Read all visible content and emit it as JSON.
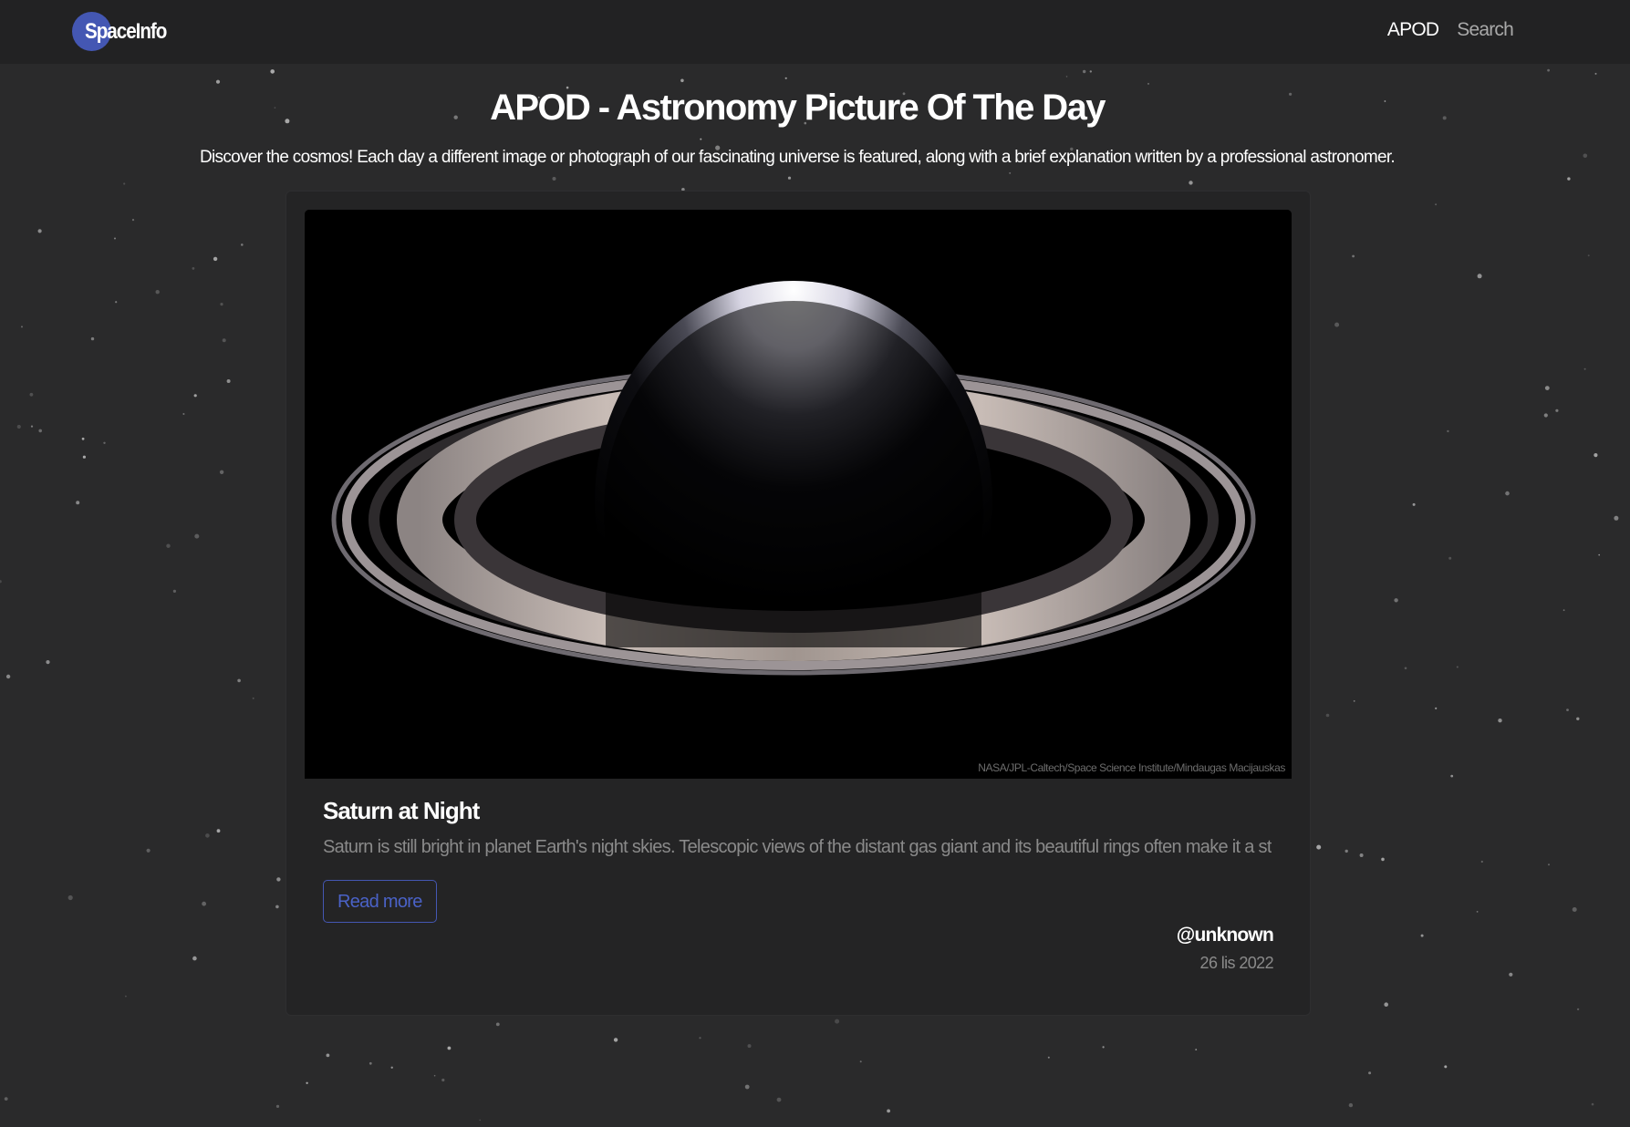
{
  "navbar": {
    "brand": "SpaceInfo",
    "links": [
      {
        "label": "APOD",
        "active": true
      },
      {
        "label": "Search",
        "active": false
      }
    ]
  },
  "page": {
    "title": "APOD - Astronomy Picture Of The Day",
    "subtitle": "Discover the cosmos! Each day a different image or photograph of our fascinating universe is featured, along with a brief explanation written by a professional astronomer."
  },
  "card": {
    "image_credit": "NASA/JPL-Caltech/Space Science Institute/Mindaugas Macijauskas",
    "title": "Saturn at Night",
    "text": "Saturn is still bright in planet Earth's night skies. Telescopic views of the distant gas giant and its beautiful rings often make it a star at star p...",
    "button_label": "Read more",
    "author": "@unknown",
    "date": "26 lis 2022"
  },
  "colors": {
    "accent": "#4457b3",
    "background": "#2a2a2b",
    "navbar": "#222223",
    "card": "#242425"
  }
}
